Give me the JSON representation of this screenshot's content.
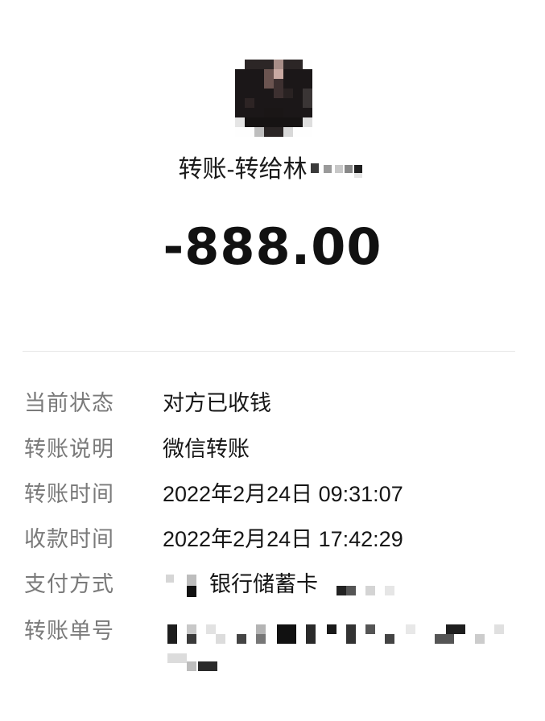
{
  "transfer": {
    "title": "转账-转给林",
    "amount": "-888.00"
  },
  "details": [
    {
      "label": "当前状态",
      "value": "对方已收钱"
    },
    {
      "label": "转账说明",
      "value": "微信转账"
    },
    {
      "label": "转账时间",
      "value": "2022年2月24日 09:31:07"
    },
    {
      "label": "收款时间",
      "value": "2022年2月24日 17:42:29"
    },
    {
      "label": "支付方式",
      "value": "银行储蓄卡"
    },
    {
      "label": "转账单号",
      "value": ""
    }
  ],
  "icons": {
    "avatar": "avatar-icon"
  }
}
